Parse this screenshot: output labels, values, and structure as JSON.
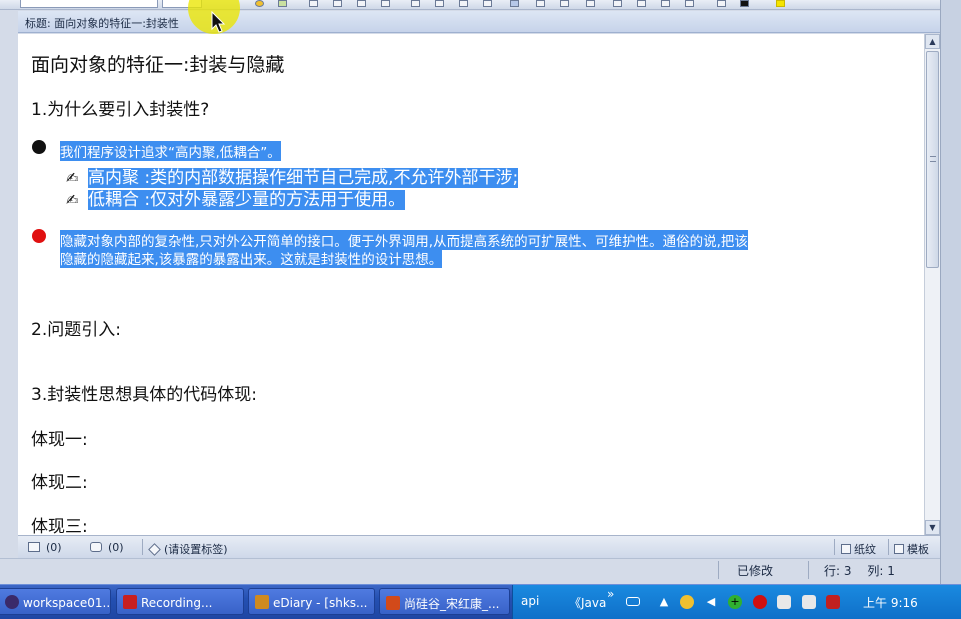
{
  "window": {
    "title_label": "标题:",
    "title_value": "面向对象的特征一:封装性"
  },
  "document": {
    "heading": "面向对象的特征一:封装与隐藏",
    "section1": "1.为什么要引入封装性?",
    "intro": "我们程序设计追求“高内聚,低耦合”。",
    "sub1": "高内聚 :类的内部数据操作细节自己完成,不允许外部干涉;",
    "sub2": "低耦合 :仅对外暴露少量的方法用于使用。",
    "hide_line1": "隐藏对象内部的复杂性,只对外公开简单的接口。便于外界调用,从而提高系统的可扩展性、可维护性。通俗的说,把该",
    "hide_line2": "隐藏的隐藏起来,该暴露的暴露出来。这就是封装性的设计思想。",
    "section2": "2.问题引入:",
    "section3": "3.封装性思想具体的代码体现:",
    "embody1": "体现一:",
    "embody2": "体现二:",
    "embody3": "体现三:"
  },
  "infobar": {
    "attach_count": "(0)",
    "comment_count": "(0)",
    "tag_placeholder": "(请设置标签)",
    "paper_label": "纸纹",
    "template_label": "模板"
  },
  "status": {
    "modified": "已修改",
    "row_label": "行:",
    "row_value": "3",
    "col_label": "列:",
    "col_value": "1"
  },
  "taskbar": {
    "tasks": [
      {
        "label": "workspace01...",
        "icon": "eclipse-icon",
        "color": "#3a2a6a"
      },
      {
        "label": "Recording...",
        "icon": "recording-icon",
        "color": "#c82020"
      },
      {
        "label": "eDiary - [shks...",
        "icon": "diary-icon",
        "color": "#d08a20"
      },
      {
        "label": "尚硅谷_宋红康_...",
        "icon": "powerpoint-icon",
        "color": "#d24a1a"
      }
    ],
    "tray_text1": "api",
    "tray_text2": "《Java",
    "tray_more": "»",
    "clock": "上午 9:16"
  },
  "colors": {
    "selection": "#3d8ef0",
    "red_bullet": "#e01010",
    "cursor_highlight": "#ebe600"
  }
}
